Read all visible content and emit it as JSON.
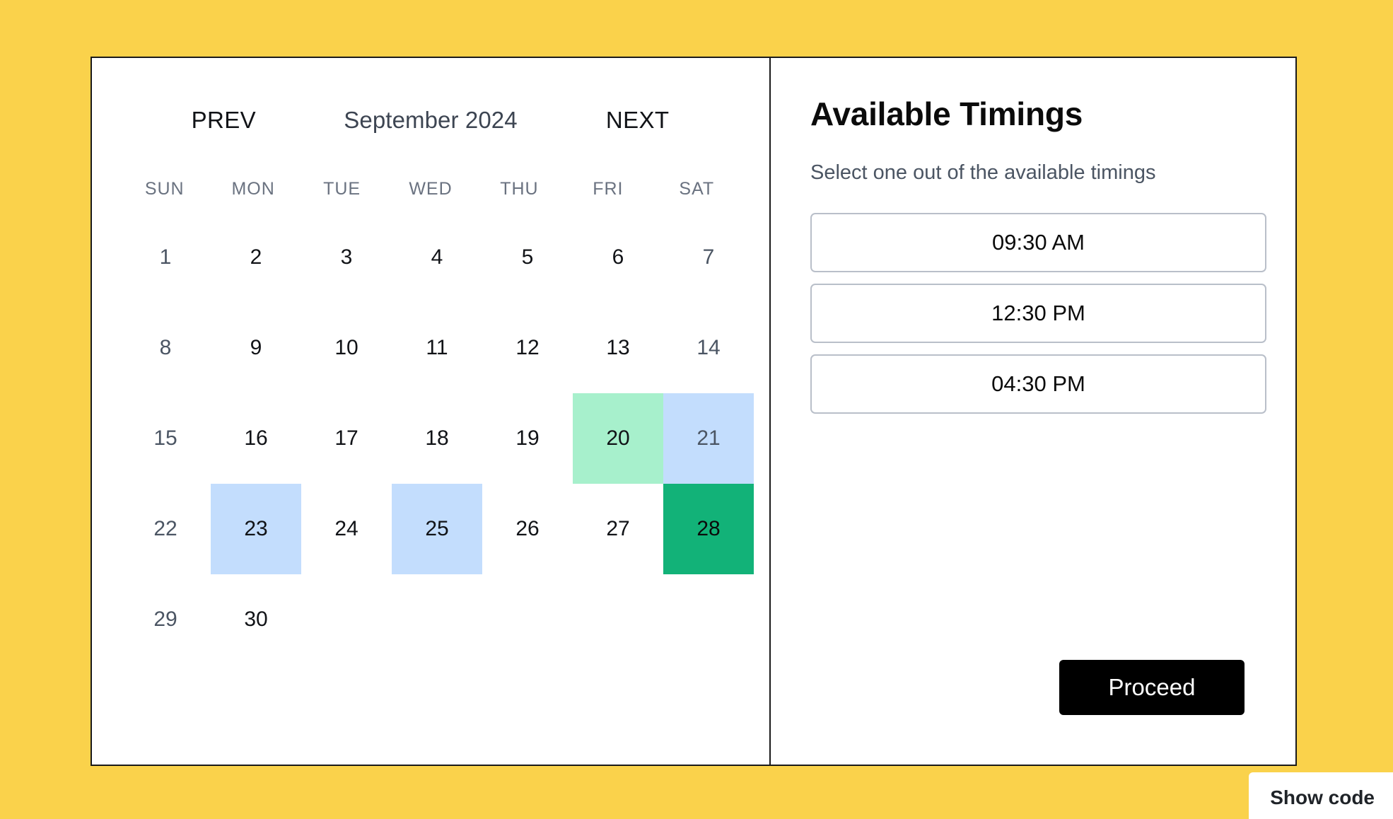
{
  "page": {
    "background_color": "#fad24b",
    "card_border_color": "#1a1a1a"
  },
  "calendar": {
    "prev_label": "PREV",
    "next_label": "NEXT",
    "month_title": "September 2024",
    "weekdays": [
      "SUN",
      "MON",
      "TUE",
      "WED",
      "THU",
      "FRI",
      "SAT"
    ],
    "leading_blanks": 0,
    "colors": {
      "blue": "#c3ddfd",
      "mint": "#a7f0cc",
      "green": "#12b278",
      "weekend_text": "#4b5563",
      "weekday_text": "#111317",
      "month_title_text": "#3d4552",
      "weekday_header_text": "#6a7280"
    },
    "days": [
      {
        "n": "1",
        "state": "plain",
        "weekend": true
      },
      {
        "n": "2",
        "state": "plain",
        "weekend": false
      },
      {
        "n": "3",
        "state": "plain",
        "weekend": false
      },
      {
        "n": "4",
        "state": "plain",
        "weekend": false
      },
      {
        "n": "5",
        "state": "plain",
        "weekend": false
      },
      {
        "n": "6",
        "state": "plain",
        "weekend": false
      },
      {
        "n": "7",
        "state": "plain",
        "weekend": true
      },
      {
        "n": "8",
        "state": "plain",
        "weekend": true
      },
      {
        "n": "9",
        "state": "plain",
        "weekend": false
      },
      {
        "n": "10",
        "state": "plain",
        "weekend": false
      },
      {
        "n": "11",
        "state": "plain",
        "weekend": false
      },
      {
        "n": "12",
        "state": "plain",
        "weekend": false
      },
      {
        "n": "13",
        "state": "plain",
        "weekend": false
      },
      {
        "n": "14",
        "state": "plain",
        "weekend": true
      },
      {
        "n": "15",
        "state": "plain",
        "weekend": true
      },
      {
        "n": "16",
        "state": "plain",
        "weekend": false
      },
      {
        "n": "17",
        "state": "plain",
        "weekend": false
      },
      {
        "n": "18",
        "state": "plain",
        "weekend": false
      },
      {
        "n": "19",
        "state": "plain",
        "weekend": false
      },
      {
        "n": "20",
        "state": "mint",
        "weekend": false
      },
      {
        "n": "21",
        "state": "blue",
        "weekend": true
      },
      {
        "n": "22",
        "state": "plain",
        "weekend": true
      },
      {
        "n": "23",
        "state": "blue",
        "weekend": false
      },
      {
        "n": "24",
        "state": "plain",
        "weekend": false
      },
      {
        "n": "25",
        "state": "blue",
        "weekend": false
      },
      {
        "n": "26",
        "state": "plain",
        "weekend": false
      },
      {
        "n": "27",
        "state": "plain",
        "weekend": false
      },
      {
        "n": "28",
        "state": "green",
        "weekend": true
      },
      {
        "n": "29",
        "state": "plain",
        "weekend": true
      },
      {
        "n": "30",
        "state": "plain",
        "weekend": false
      }
    ]
  },
  "timings": {
    "title": "Available Timings",
    "subtitle": "Select one out of the available timings",
    "slots": [
      {
        "label": "09:30 AM"
      },
      {
        "label": "12:30 PM"
      },
      {
        "label": "04:30 PM"
      }
    ],
    "proceed_label": "Proceed"
  },
  "footer": {
    "show_code_label": "Show code"
  }
}
